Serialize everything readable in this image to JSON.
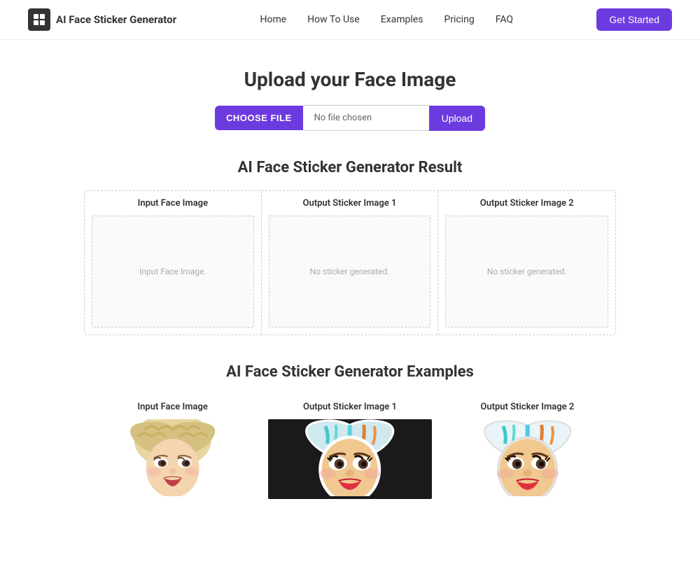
{
  "brand": {
    "name": "AI Face Sticker Generator",
    "icon_alt": "AI logo"
  },
  "nav": {
    "links": [
      {
        "label": "Home",
        "href": "#"
      },
      {
        "label": "How To Use",
        "href": "#"
      },
      {
        "label": "Examples",
        "href": "#"
      },
      {
        "label": "Pricing",
        "href": "#"
      },
      {
        "label": "FAQ",
        "href": "#"
      }
    ],
    "cta_label": "Get Started"
  },
  "upload": {
    "title": "Upload your Face Image",
    "choose_file_label": "CHOOSE FILE",
    "file_name_placeholder": "No file chosen",
    "upload_button_label": "Upload"
  },
  "result": {
    "section_title": "AI Face Sticker Generator Result",
    "columns": [
      {
        "header": "Input Face Image",
        "placeholder": "Input Face Image."
      },
      {
        "header": "Output Sticker Image 1",
        "placeholder": "No sticker generated."
      },
      {
        "header": "Output Sticker Image 2",
        "placeholder": "No sticker generated."
      }
    ]
  },
  "examples": {
    "section_title": "AI Face Sticker Generator Examples",
    "columns": [
      {
        "header": "Input Face Image"
      },
      {
        "header": "Output Sticker Image 1"
      },
      {
        "header": "Output Sticker Image 2"
      }
    ]
  },
  "colors": {
    "primary": "#6c3be0",
    "primary_hover": "#5a2ec0",
    "text_dark": "#333",
    "text_light": "#aaa",
    "border": "#ccc"
  }
}
